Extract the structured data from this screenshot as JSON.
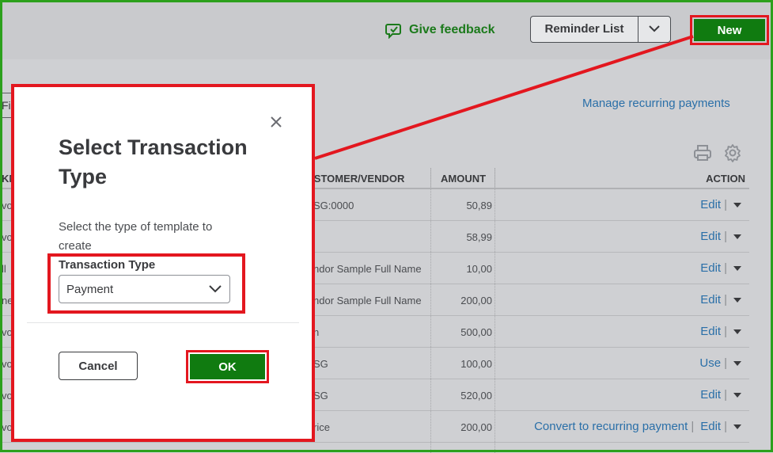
{
  "header": {
    "feedback_label": "Give feedback",
    "reminder_label": "Reminder List",
    "new_label": "New"
  },
  "page": {
    "tab_stub": "Fi",
    "manage_link": "Manage recurring payments"
  },
  "table": {
    "headers": {
      "c0": "KN",
      "customer": "CUSTOMER/VENDOR",
      "amount": "AMOUNT",
      "action": "ACTION"
    },
    "rows": [
      {
        "c0": "vo",
        "customer": "SG:0000",
        "amount": "50,89",
        "actions": [
          "Edit"
        ]
      },
      {
        "c0": "vo",
        "customer": "",
        "amount": "58,99",
        "actions": [
          "Edit"
        ]
      },
      {
        "c0": "ll",
        "customer": "ndor Sample Full Name",
        "amount": "10,00",
        "actions": [
          "Edit"
        ]
      },
      {
        "c0": "ne",
        "customer": "ndor Sample Full Name",
        "amount": "200,00",
        "actions": [
          "Edit"
        ]
      },
      {
        "c0": "vo",
        "customer": "n",
        "amount": "500,00",
        "actions": [
          "Edit"
        ]
      },
      {
        "c0": "vo",
        "customer": "SG",
        "amount": "100,00",
        "actions": [
          "Use"
        ]
      },
      {
        "c0": "vo",
        "customer": "SG",
        "amount": "520,00",
        "actions": [
          "Edit"
        ]
      },
      {
        "c0": "vo",
        "customer": "rice",
        "amount": "200,00",
        "actions": [
          "Convert to recurring payment",
          "Edit"
        ]
      }
    ]
  },
  "modal": {
    "title": "Select Transaction Type",
    "description": "Select the type of template to create",
    "field_label": "Transaction Type",
    "selected_value": "Payment",
    "cancel_label": "Cancel",
    "ok_label": "OK"
  },
  "colors": {
    "accent_green": "#107b10",
    "highlight_red": "#e3171f",
    "link_blue": "#2a6fa8"
  }
}
